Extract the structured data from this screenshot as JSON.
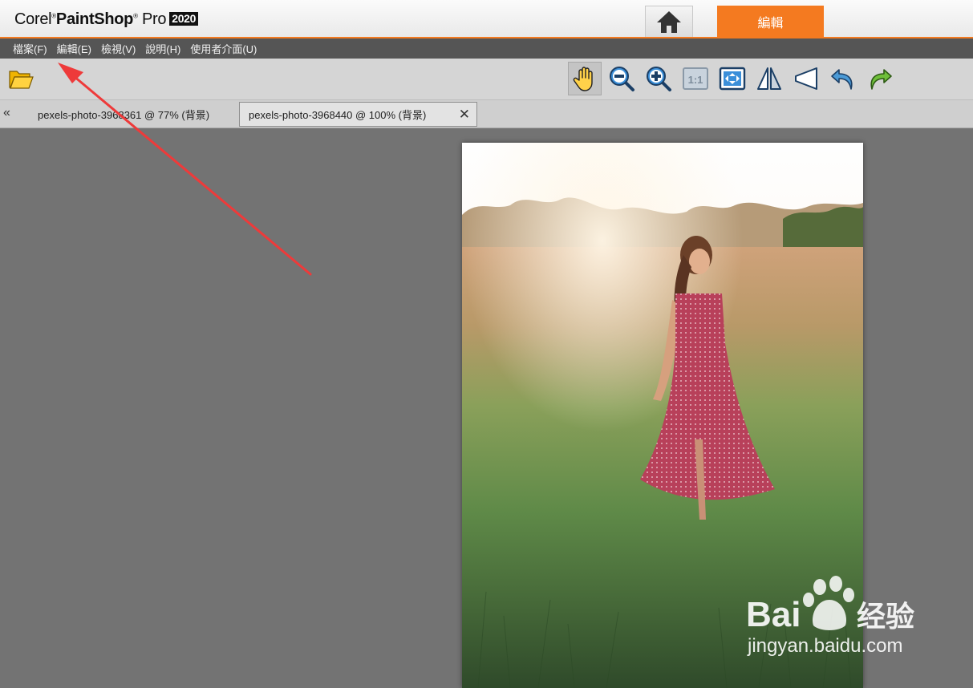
{
  "app": {
    "brand_corel": "Corel",
    "brand_paint": "PaintShop",
    "brand_pro": "Pro",
    "brand_year": "2020",
    "edit_tab_label": "編輯"
  },
  "menu": [
    {
      "label": "檔案(F)"
    },
    {
      "label": "編輯(E)"
    },
    {
      "label": "檢視(V)"
    },
    {
      "label": "說明(H)"
    },
    {
      "label": "使用者介面(U)"
    }
  ],
  "toolbar": {
    "icons": [
      "open-folder-icon",
      "pan-hand-icon",
      "zoom-out-icon",
      "zoom-in-icon",
      "actual-size-icon",
      "fit-window-icon",
      "straighten-icon",
      "perspective-icon",
      "undo-icon",
      "redo-icon"
    ],
    "actual_size_label": "1:1"
  },
  "tabs": [
    {
      "label": "pexels-photo-3968361 @  77% (背景)"
    },
    {
      "label": "pexels-photo-3968440 @ 100% (背景)"
    }
  ],
  "watermark": {
    "brand": "Bai",
    "brand_cn": "经验",
    "url": "jingyan.baidu.com"
  },
  "colors": {
    "accent": "#f47a20",
    "menubar": "#555555",
    "workspace": "#737373",
    "annotation_arrow": "#ee3a3a"
  }
}
